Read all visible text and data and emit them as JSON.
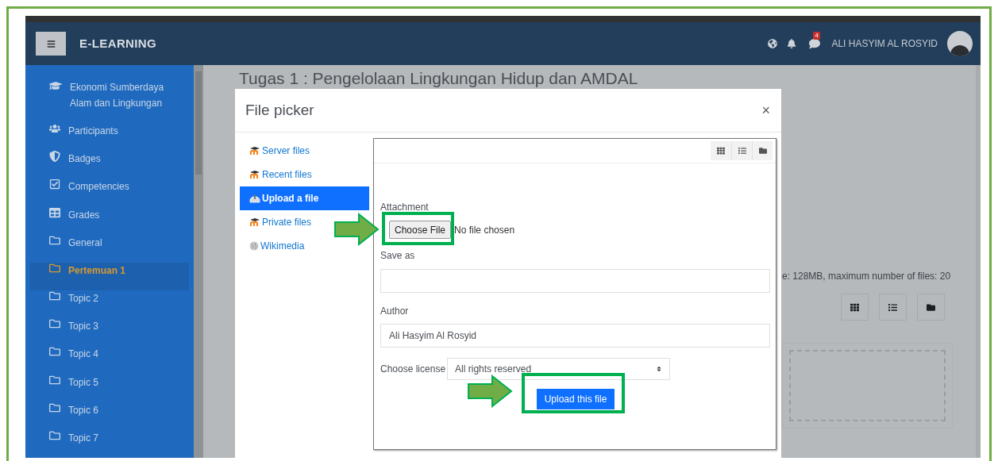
{
  "navbar": {
    "brand": "E-LEARNING",
    "message_count": "4",
    "user_name": "ALI HASYIM AL ROSYID"
  },
  "sidebar": {
    "items": [
      {
        "label": "Ekonomi Sumberdaya Alam dan Lingkungan",
        "kind": "course",
        "selected": false
      },
      {
        "label": "Participants",
        "kind": "participants",
        "selected": false
      },
      {
        "label": "Badges",
        "kind": "badges",
        "selected": false
      },
      {
        "label": "Competencies",
        "kind": "competencies",
        "selected": false
      },
      {
        "label": "Grades",
        "kind": "grades",
        "selected": false
      },
      {
        "label": "General",
        "kind": "folder",
        "selected": false
      },
      {
        "label": "Pertemuan 1",
        "kind": "folder",
        "selected": true
      },
      {
        "label": "Topic 2",
        "kind": "folder",
        "selected": false
      },
      {
        "label": "Topic 3",
        "kind": "folder",
        "selected": false
      },
      {
        "label": "Topic 4",
        "kind": "folder",
        "selected": false
      },
      {
        "label": "Topic 5",
        "kind": "folder",
        "selected": false
      },
      {
        "label": "Topic 6",
        "kind": "folder",
        "selected": false
      },
      {
        "label": "Topic 7",
        "kind": "folder",
        "selected": false
      }
    ]
  },
  "page": {
    "title": "Tugas 1 : Pengelolaan Lingkungan Hidup dan AMDAL",
    "file_limits": "e: 128MB, maximum number of files: 20"
  },
  "file_picker": {
    "title": "File picker",
    "close": "×",
    "repositories": [
      {
        "label": "Server files",
        "kind": "moodle",
        "selected": false
      },
      {
        "label": "Recent files",
        "kind": "moodle",
        "selected": false
      },
      {
        "label": "Upload a file",
        "kind": "upload",
        "selected": true
      },
      {
        "label": "Private files",
        "kind": "moodle",
        "selected": false
      },
      {
        "label": "Wikimedia",
        "kind": "wikimedia",
        "selected": false
      }
    ],
    "attachment_label": "Attachment",
    "choose_file_button": "Choose File",
    "file_status": "No file chosen",
    "save_as_label": "Save as",
    "author_label": "Author",
    "author_value": "Ali Hasyim Al Rosyid",
    "license_label": "Choose license",
    "license_value": "All rights reserved",
    "upload_button": "Upload this file"
  }
}
